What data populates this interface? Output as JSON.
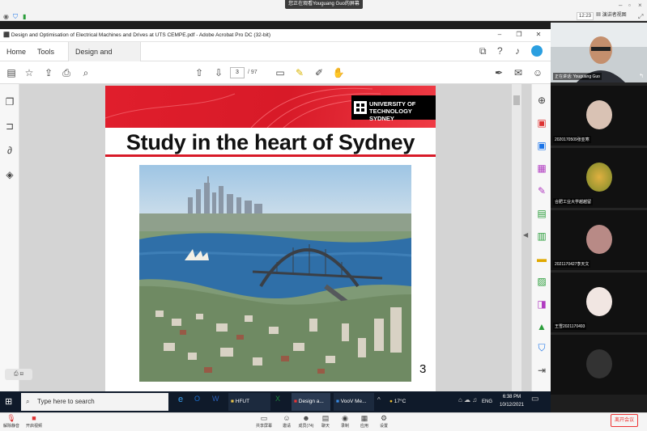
{
  "meeting": {
    "share_notice": "您正在观看Youguang Guo的屏幕",
    "time_badge": "12:23",
    "layout_label": "演讲者视图",
    "end_button": "离开会议",
    "bottom_controls": [
      {
        "icon": "mic-icon",
        "label": "解除静音"
      },
      {
        "icon": "camera-icon",
        "label": "开启视频"
      },
      {
        "icon": "share-icon",
        "label": "共享屏幕"
      },
      {
        "icon": "invite-icon",
        "label": "邀请"
      },
      {
        "icon": "members-icon",
        "label": "成员(74)"
      },
      {
        "icon": "chat-icon",
        "label": "聊天"
      },
      {
        "icon": "record-icon",
        "label": "录制"
      },
      {
        "icon": "apps-icon",
        "label": "应用"
      },
      {
        "icon": "settings-icon",
        "label": "设置"
      }
    ],
    "participants": [
      {
        "name": "正在讲话: Youguang Guo"
      },
      {
        "name": "2020170509张亚寒"
      },
      {
        "name": "合肥工业大学越越留"
      },
      {
        "name": "2021170427李天文"
      },
      {
        "name": "王雪2021170493"
      },
      {
        "name": ""
      }
    ]
  },
  "acrobat": {
    "window_title": "Design and Optimisation of Electrical Machines and Drives at UTS CEMPE.pdf - Adobe Acrobat Pro DC (32-bit)",
    "tabs": {
      "home": "Home",
      "tools": "Tools",
      "doc": "Design and Optimi..."
    },
    "page_current": "3",
    "page_total": "/ 97"
  },
  "slide": {
    "logo_line1": "UNIVERSITY OF",
    "logo_line2": "TECHNOLOGY SYDNEY",
    "title": "Study in the heart of Sydney",
    "page_number": "3"
  },
  "taskbar": {
    "search_placeholder": "Type here to search",
    "apps": [
      {
        "label": "HFUT"
      },
      {
        "label": "Design a..."
      },
      {
        "label": "VooV Me..."
      }
    ],
    "weather": "17°C",
    "lang": "ENG",
    "clock_time": "6:38 PM",
    "clock_date": "10/12/2021"
  },
  "colors": {
    "brand_red": "#d81a28",
    "taskbar": "#0f1a2a",
    "end_red": "#e33333"
  }
}
